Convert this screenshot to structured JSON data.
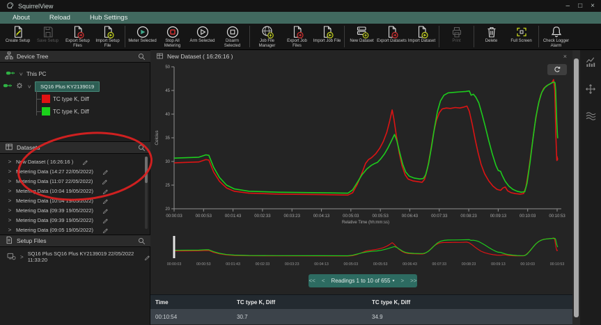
{
  "window": {
    "title": "SquirrelView",
    "minimize": "–",
    "maximize": "□",
    "close": "×"
  },
  "menu": {
    "items": [
      "About",
      "Reload",
      "Hub Settings"
    ]
  },
  "toolbar": {
    "groups": [
      {
        "buttons": [
          {
            "label": "Create Setup",
            "icon": "doc-pencil",
            "disabled": false
          },
          {
            "label": "Save Setup",
            "icon": "save",
            "disabled": true
          },
          {
            "label": "Export Setup Files",
            "icon": "doc-export",
            "disabled": false
          },
          {
            "label": "Import Setup File",
            "icon": "doc-import",
            "disabled": false
          }
        ]
      },
      {
        "buttons": [
          {
            "label": "Meter Selected",
            "icon": "gauge",
            "disabled": false
          },
          {
            "label": "Stop All Metering",
            "icon": "stop-red",
            "disabled": false
          },
          {
            "label": "Arm Selected",
            "icon": "play",
            "disabled": false
          },
          {
            "label": "Disarm Selected",
            "icon": "stop",
            "disabled": false
          }
        ]
      },
      {
        "buttons": [
          {
            "label": "Job File Manager",
            "icon": "globe-plus",
            "disabled": false
          },
          {
            "label": "Export Job Files",
            "icon": "doc-export",
            "disabled": false
          },
          {
            "label": "Import Job File",
            "icon": "doc-import",
            "disabled": false
          }
        ]
      },
      {
        "buttons": [
          {
            "label": "New Dataset",
            "icon": "server-plus",
            "disabled": false
          },
          {
            "label": "Export Datasets",
            "icon": "doc-export",
            "disabled": false
          },
          {
            "label": "Import Dataset",
            "icon": "doc-import",
            "disabled": false
          }
        ]
      },
      {
        "buttons": [
          {
            "label": "Print",
            "icon": "printer",
            "disabled": true
          }
        ]
      },
      {
        "buttons": [
          {
            "label": "Delete",
            "icon": "trash",
            "disabled": false
          },
          {
            "label": "Full Screen",
            "icon": "fullscreen",
            "disabled": false
          }
        ]
      },
      {
        "buttons": [
          {
            "label": "Check Logger Alarm",
            "icon": "bell",
            "disabled": false
          }
        ]
      }
    ]
  },
  "device_tree": {
    "header": "Device Tree",
    "root_label": "This PC",
    "device_label": "SQ16 Plus KY2139019",
    "channels": [
      {
        "label": "TC type K, Diff",
        "color": "#e11212"
      },
      {
        "label": "TC type K, Diff",
        "color": "#1bd11b"
      }
    ]
  },
  "datasets": {
    "header": "Datasets",
    "items": [
      "New Dataset ( 16:26:16 )",
      "Metering Data (14:27 22/05/2022)",
      "Metering Data (11:07 22/05/2022)",
      "Metering Data (10:04 19/05/2022)",
      "Metering Data (10:04 19/05/2022)",
      "Metering Data (09:39 19/05/2022)",
      "Metering Data (09:39 19/05/2022)",
      "Metering Data (09:05 19/05/2022)"
    ]
  },
  "setup_files": {
    "header": "Setup Files",
    "items": [
      "SQ16 Plus SQ16 Plus KY2139019 22/05/2022 11:33:20"
    ]
  },
  "chart_panel": {
    "title": "New Dataset ( 16:26:16 )",
    "close": "×"
  },
  "chart_data": {
    "type": "line",
    "title": "New Dataset ( 16:26:16 )",
    "xlabel": "Relative Time (hh:mm:ss)",
    "ylabel": "Celcius",
    "ylim": [
      20,
      50
    ],
    "yticks": [
      20,
      25,
      30,
      35,
      40,
      45,
      50
    ],
    "xtick_labels": [
      "00:00:03",
      "00:00:53",
      "00:01:43",
      "00:02:33",
      "00:03:23",
      "00:04:13",
      "00:05:03",
      "00:05:53",
      "00:06:43",
      "00:07:33",
      "00:08:23",
      "00:09:13",
      "00:10:03",
      "00:10:53"
    ],
    "x_seconds_range": [
      3,
      654
    ],
    "grid": false,
    "legend": false,
    "has_overview_chart": true,
    "series": [
      {
        "name": "TC type K, Diff",
        "color": "#dc1414",
        "points": [
          [
            3,
            29.7
          ],
          [
            45,
            29.9
          ],
          [
            57,
            30.4
          ],
          [
            62,
            30.3
          ],
          [
            70,
            27.8
          ],
          [
            80,
            25.8
          ],
          [
            92,
            24.4
          ],
          [
            105,
            23.7
          ],
          [
            130,
            23.3
          ],
          [
            180,
            23.1
          ],
          [
            250,
            23.0
          ],
          [
            298,
            22.9
          ],
          [
            306,
            23.4
          ],
          [
            314,
            25.2
          ],
          [
            322,
            27.6
          ],
          [
            328,
            29.6
          ],
          [
            333,
            30.4
          ],
          [
            338,
            30.8
          ],
          [
            345,
            31.6
          ],
          [
            352,
            32.8
          ],
          [
            358,
            34.2
          ],
          [
            364,
            36.2
          ],
          [
            369,
            38.6
          ],
          [
            373,
            40.9
          ],
          [
            376,
            39.0
          ],
          [
            380,
            35.6
          ],
          [
            385,
            31.8
          ],
          [
            390,
            29.0
          ],
          [
            395,
            27.2
          ],
          [
            400,
            26.3
          ],
          [
            408,
            25.9
          ],
          [
            418,
            25.7
          ],
          [
            424,
            25.6
          ],
          [
            428,
            26.2
          ],
          [
            433,
            28.5
          ],
          [
            438,
            32.0
          ],
          [
            443,
            35.8
          ],
          [
            448,
            38.6
          ],
          [
            453,
            40.3
          ],
          [
            458,
            41.1
          ],
          [
            465,
            41.3
          ],
          [
            472,
            41.2
          ],
          [
            480,
            41.4
          ],
          [
            488,
            41.3
          ],
          [
            495,
            41.5
          ],
          [
            500,
            41.7
          ],
          [
            504,
            40.6
          ],
          [
            509,
            37.8
          ],
          [
            514,
            34.6
          ],
          [
            519,
            31.8
          ],
          [
            524,
            29.4
          ],
          [
            530,
            27.4
          ],
          [
            537,
            25.9
          ],
          [
            544,
            24.8
          ],
          [
            551,
            24.1
          ],
          [
            557,
            23.9
          ],
          [
            561,
            24.4
          ],
          [
            565,
            24.6
          ],
          [
            569,
            23.8
          ],
          [
            575,
            23.4
          ],
          [
            582,
            23.2
          ],
          [
            590,
            23.1
          ],
          [
            596,
            23.2
          ],
          [
            600,
            24.6
          ],
          [
            605,
            28.4
          ],
          [
            610,
            33.0
          ],
          [
            615,
            37.6
          ],
          [
            620,
            41.4
          ],
          [
            625,
            44.0
          ],
          [
            630,
            45.4
          ],
          [
            635,
            46.0
          ],
          [
            640,
            46.3
          ],
          [
            644,
            46.6
          ],
          [
            647,
            47.3
          ],
          [
            649,
            45.0
          ],
          [
            650,
            40.0
          ],
          [
            651,
            35.0
          ],
          [
            652,
            31.5
          ],
          [
            652.5,
            30.2
          ],
          [
            653,
            31.0
          ],
          [
            653.5,
            30.3
          ],
          [
            654,
            30.7
          ]
        ]
      },
      {
        "name": "TC type K, Diff",
        "color": "#1dcc1d",
        "points": [
          [
            3,
            30.7
          ],
          [
            45,
            30.9
          ],
          [
            57,
            31.4
          ],
          [
            62,
            31.3
          ],
          [
            70,
            28.8
          ],
          [
            80,
            26.6
          ],
          [
            92,
            25.0
          ],
          [
            105,
            24.2
          ],
          [
            130,
            23.7
          ],
          [
            180,
            23.5
          ],
          [
            250,
            23.4
          ],
          [
            298,
            23.3
          ],
          [
            306,
            24.0
          ],
          [
            314,
            25.6
          ],
          [
            322,
            27.2
          ],
          [
            330,
            28.4
          ],
          [
            338,
            29.2
          ],
          [
            344,
            29.6
          ],
          [
            348,
            29.8
          ],
          [
            354,
            30.6
          ],
          [
            360,
            31.6
          ],
          [
            366,
            32.9
          ],
          [
            372,
            34.4
          ],
          [
            377,
            35.7
          ],
          [
            381,
            34.4
          ],
          [
            386,
            31.8
          ],
          [
            391,
            29.4
          ],
          [
            396,
            27.8
          ],
          [
            402,
            26.9
          ],
          [
            410,
            26.5
          ],
          [
            420,
            26.3
          ],
          [
            426,
            26.4
          ],
          [
            430,
            27.2
          ],
          [
            435,
            29.6
          ],
          [
            440,
            33.2
          ],
          [
            445,
            37.2
          ],
          [
            450,
            40.6
          ],
          [
            455,
            42.8
          ],
          [
            461,
            44.0
          ],
          [
            468,
            44.5
          ],
          [
            478,
            44.6
          ],
          [
            488,
            44.7
          ],
          [
            498,
            44.8
          ],
          [
            504,
            44.9
          ],
          [
            507,
            44.0
          ],
          [
            511,
            44.2
          ],
          [
            515,
            43.6
          ],
          [
            520,
            42.4
          ],
          [
            526,
            39.8
          ],
          [
            531,
            37.4
          ],
          [
            537,
            34.4
          ],
          [
            543,
            31.6
          ],
          [
            549,
            29.2
          ],
          [
            553,
            28.1
          ],
          [
            557,
            27.9
          ],
          [
            560,
            27.0
          ],
          [
            565,
            25.8
          ],
          [
            571,
            24.8
          ],
          [
            578,
            24.1
          ],
          [
            585,
            23.7
          ],
          [
            592,
            23.5
          ],
          [
            598,
            23.6
          ],
          [
            602,
            25.4
          ],
          [
            607,
            29.8
          ],
          [
            612,
            34.8
          ],
          [
            617,
            39.4
          ],
          [
            622,
            42.6
          ],
          [
            627,
            44.6
          ],
          [
            632,
            45.6
          ],
          [
            638,
            46.2
          ],
          [
            644,
            46.6
          ],
          [
            648,
            46.8
          ],
          [
            649.5,
            46.6
          ],
          [
            650.5,
            45.0
          ],
          [
            651.5,
            41.5
          ],
          [
            652.5,
            38.0
          ],
          [
            653.5,
            35.8
          ],
          [
            654,
            34.9
          ]
        ]
      }
    ]
  },
  "pager": {
    "first": "<<",
    "prev": "<",
    "label": "Readings 1 to 10 of 655",
    "caret": "▾",
    "next": ">",
    "last": ">>"
  },
  "table": {
    "headers": [
      "Time",
      "TC type K, Diff",
      "TC type K, Diff"
    ],
    "rows": [
      [
        "00:10:54",
        "30.7",
        "34.9"
      ]
    ]
  },
  "right_toolbar": {
    "icons": [
      "combo-chart",
      "pan",
      "waves"
    ]
  },
  "colors": {
    "menu_teal": "#41695f",
    "accent_teal": "#2d6b61",
    "selected_device_bg": "#2d5e54",
    "red_series": "#dc1414",
    "green_series": "#1dcc1d",
    "annotation_red": "#d92121",
    "toolbar_yellow": "#c6d41e",
    "toolbar_red": "#d33030",
    "toolbar_teal": "#3fa98c"
  }
}
